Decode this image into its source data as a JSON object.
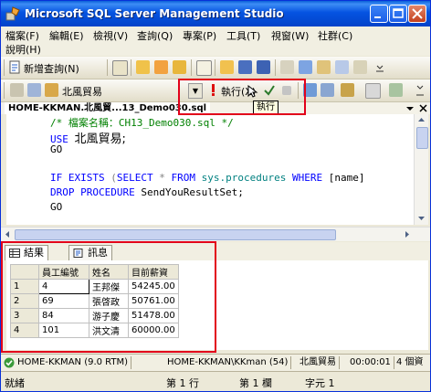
{
  "window": {
    "title": "Microsoft SQL Server Management Studio"
  },
  "menu": {
    "items": [
      "檔案(F)",
      "編輯(E)",
      "檢視(V)",
      "查詢(Q)",
      "專案(P)",
      "工具(T)",
      "視窗(W)",
      "社群(C)",
      "說明(H)"
    ]
  },
  "toolbar1": {
    "new_query_label": "新增查詢(N)"
  },
  "toolbar2": {
    "database": "北風貿易",
    "execute_label": "執行(X)"
  },
  "tooltip": {
    "text": "執行"
  },
  "doc_tab": {
    "title": "HOME-KKMAN.北風貿...13_Demo030.sql"
  },
  "editor": {
    "line1": "/* 檔案名稱：CH13_Demo030.sql */",
    "line2_kw": "USE",
    "line2_db": "北風貿易;",
    "line3": "GO",
    "line5_kw1": "IF EXISTS",
    "line5_p1": " (",
    "line5_kw2": "SELECT",
    "line5_rest": " * ",
    "line5_kw3": "FROM",
    "line5_sys": " sys.procedures ",
    "line5_kw4": "WHERE",
    "line5_tail": " [name]",
    "line6_kw": "DROP PROCEDURE",
    "line6_rest": " SendYouResultSet;",
    "line7": "GO"
  },
  "results": {
    "tab_results": "結果",
    "tab_messages": "訊息",
    "columns": [
      "員工編號",
      "姓名",
      "目前薪資"
    ],
    "rows": [
      [
        "1",
        "4",
        "王邦傑",
        "54245.00"
      ],
      [
        "2",
        "69",
        "張啓政",
        "50761.00"
      ],
      [
        "3",
        "84",
        "游子慶",
        "51478.00"
      ],
      [
        "4",
        "101",
        "洪文清",
        "60000.00"
      ]
    ]
  },
  "status": {
    "server": "HOME-KKMAN (9.0 RTM)",
    "user": "HOME-KKMAN\\KKman (54)",
    "database": "北風貿易",
    "elapsed": "00:00:01",
    "rows": "4 個資",
    "ready": "就緒",
    "line": "第 1 行",
    "col": "第 1 欄",
    "ch": "字元 1"
  }
}
